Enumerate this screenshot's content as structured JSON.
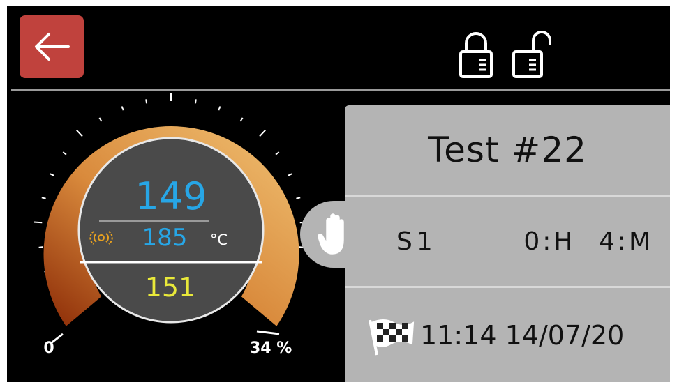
{
  "header": {
    "back_icon": "arrow-left-icon",
    "lock_icon": "lock-closed-icon",
    "unlock_icon": "lock-open-icon",
    "back_color": "#c0423d"
  },
  "gauge": {
    "current_temp": "149",
    "set_temp": "185",
    "unit": "°C",
    "min_temp": "151",
    "scale_min": "0",
    "scale_max": "34 %",
    "fill_fraction": 0.34,
    "fan_icon": "fan-icon",
    "current_color": "#27a6e6",
    "min_color": "#e9e93a"
  },
  "program": {
    "title": "Test #22",
    "stage": "S1",
    "timer": "0:H 4:M",
    "finish_time": "11:14 14/07/20",
    "hand_icon": "hand-stop-icon",
    "flag_icon": "checkered-flag-icon"
  }
}
